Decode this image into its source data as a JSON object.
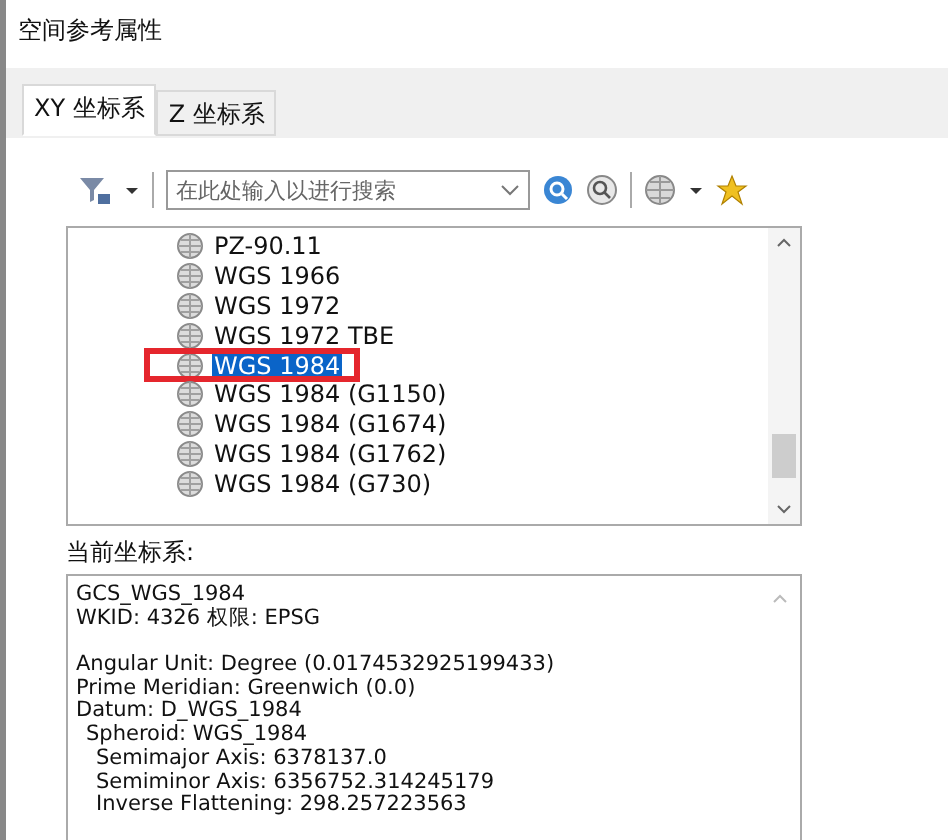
{
  "window": {
    "title": "空间参考属性"
  },
  "tabs": [
    {
      "label": "XY 坐标系",
      "selected": true
    },
    {
      "label": "Z 坐标系",
      "selected": false
    }
  ],
  "search": {
    "placeholder": "在此处输入以进行搜索"
  },
  "list": {
    "items": [
      {
        "label": "PZ-90.11",
        "selected": false,
        "highlighted": false
      },
      {
        "label": "WGS 1966",
        "selected": false,
        "highlighted": false
      },
      {
        "label": "WGS 1972",
        "selected": false,
        "highlighted": false
      },
      {
        "label": "WGS 1972 TBE",
        "selected": false,
        "highlighted": false
      },
      {
        "label": "WGS 1984",
        "selected": true,
        "highlighted": true
      },
      {
        "label": "WGS 1984 (G1150)",
        "selected": false,
        "highlighted": false
      },
      {
        "label": "WGS 1984 (G1674)",
        "selected": false,
        "highlighted": false
      },
      {
        "label": "WGS 1984 (G1762)",
        "selected": false,
        "highlighted": false
      },
      {
        "label": "WGS 1984 (G730)",
        "selected": false,
        "highlighted": false
      }
    ]
  },
  "current": {
    "label": "当前坐标系:",
    "header": [
      "GCS_WGS_1984",
      "WKID: 4326 权限: EPSG"
    ],
    "params": [
      {
        "text": "Angular Unit: Degree (0.0174532925199433)"
      },
      {
        "text": "Prime Meridian: Greenwich (0.0)"
      },
      {
        "text": "Datum: D_WGS_1984",
        "children": [
          {
            "text": "Spheroid: WGS_1984",
            "children": [
              {
                "text": "Semimajor Axis: 6378137.0"
              },
              {
                "text": "Semiminor Axis: 6356752.314245179"
              },
              {
                "text": "Inverse Flattening: 298.257223563"
              }
            ]
          }
        ]
      }
    ]
  }
}
